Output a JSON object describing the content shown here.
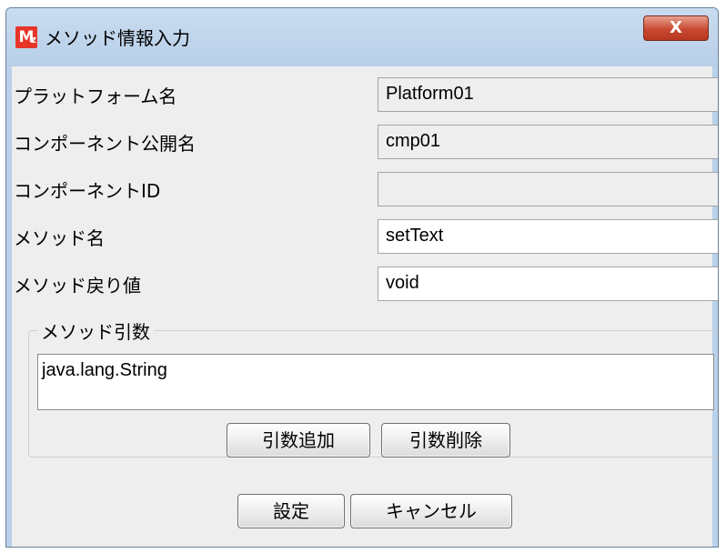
{
  "window": {
    "title": "メソッド情報入力",
    "app_icon": "M-z-app-icon",
    "close_glyph": "X"
  },
  "fields": [
    {
      "label": "プラットフォーム名",
      "value": "Platform01",
      "editable": false
    },
    {
      "label": "コンポーネント公開名",
      "value": "cmp01",
      "editable": false
    },
    {
      "label": "コンポーネントID",
      "value": "",
      "editable": false
    },
    {
      "label": "メソッド名",
      "value": "setText",
      "editable": true
    },
    {
      "label": "メソッド戻り値",
      "value": "void",
      "editable": true
    }
  ],
  "arguments": {
    "legend": "メソッド引数",
    "items": [
      "java.lang.String"
    ],
    "add_label": "引数追加",
    "delete_label": "引数削除"
  },
  "buttons": {
    "ok_label": "設定",
    "cancel_label": "キャンセル"
  },
  "colors": {
    "title_bar": "#b9d1ea",
    "close_button": "#c84a32",
    "app_icon": "#e8352a",
    "client_bg": "#eeeeee"
  }
}
